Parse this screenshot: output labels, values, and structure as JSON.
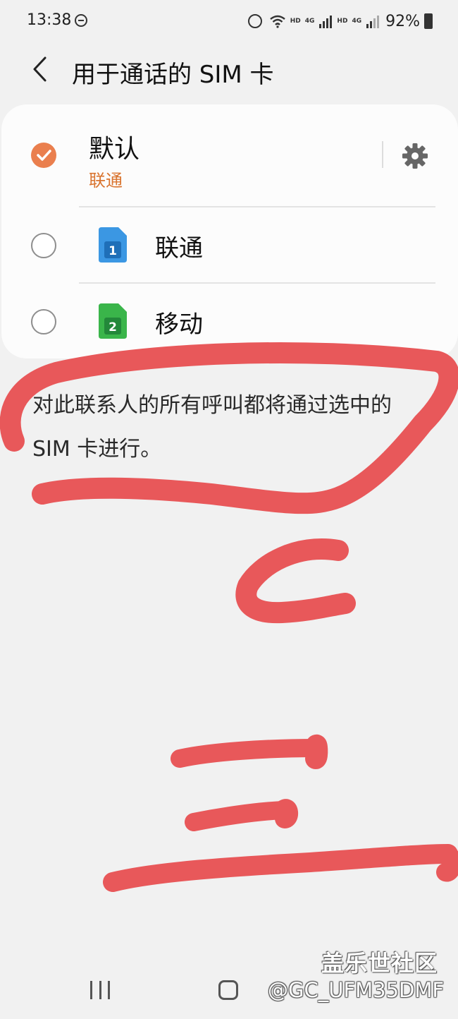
{
  "status_bar": {
    "time": "13:38",
    "hd_1": "HD",
    "net_1": "4G",
    "hd_2": "HD",
    "net_2": "4G",
    "battery": "92%"
  },
  "header": {
    "title": "用于通话的 SIM 卡"
  },
  "options": {
    "default": {
      "label": "默认",
      "sub_label": "联通",
      "selected": true
    },
    "sim1": {
      "label": "联通",
      "sim_number": "1",
      "color": "#3b97e3",
      "selected": false
    },
    "sim2": {
      "label": "移动",
      "sim_number": "2",
      "color": "#3ab54a",
      "selected": false
    }
  },
  "description": "对此联系人的所有呼叫都将通过选中的 SIM 卡进行。",
  "colors": {
    "accent": "#ea7f4e",
    "accent_text": "#d9742f",
    "scribble": "#e8585a"
  },
  "watermark": {
    "site": "盖乐世社区",
    "user": "@GC_UFM35DMF"
  }
}
